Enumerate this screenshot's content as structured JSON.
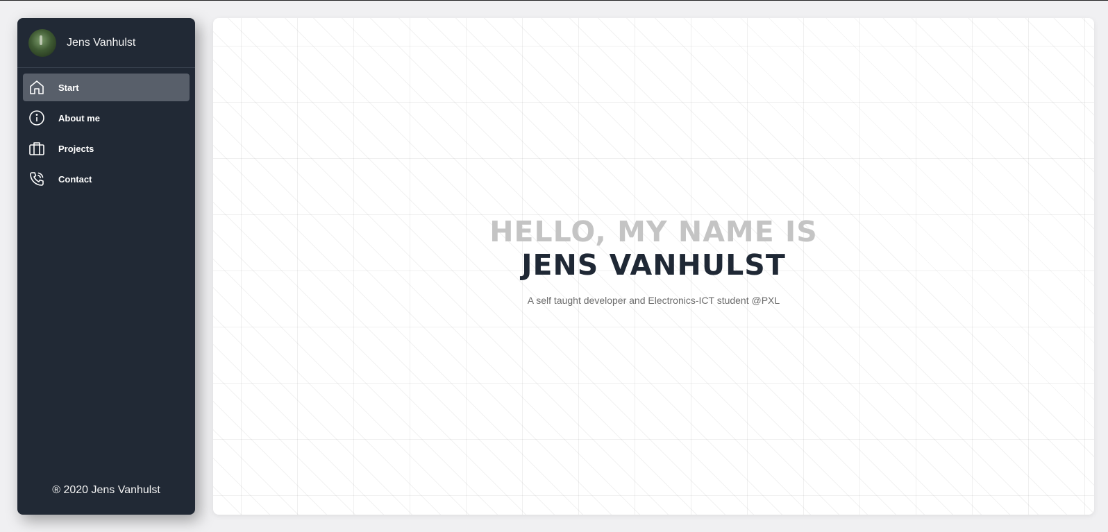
{
  "sidebar": {
    "profile": {
      "name": "Jens Vanhulst",
      "avatar": "profile-photo"
    },
    "items": [
      {
        "label": "Start",
        "icon": "home-icon",
        "active": true
      },
      {
        "label": "About me",
        "icon": "info-icon",
        "active": false
      },
      {
        "label": "Projects",
        "icon": "briefcase-icon",
        "active": false
      },
      {
        "label": "Contact",
        "icon": "phone-icon",
        "active": false
      }
    ],
    "copyright": "® 2020 Jens Vanhulst"
  },
  "hero": {
    "greeting": "HELLO, MY NAME IS",
    "name": "JENS VANHULST",
    "subtitle": "A self taught developer and Electronics-ICT student @PXL"
  },
  "colors": {
    "sidebar_bg": "#212935",
    "active_item_bg": "#585f6a",
    "hero_greeting": "#c4c4c4",
    "hero_name": "#1f2835"
  }
}
